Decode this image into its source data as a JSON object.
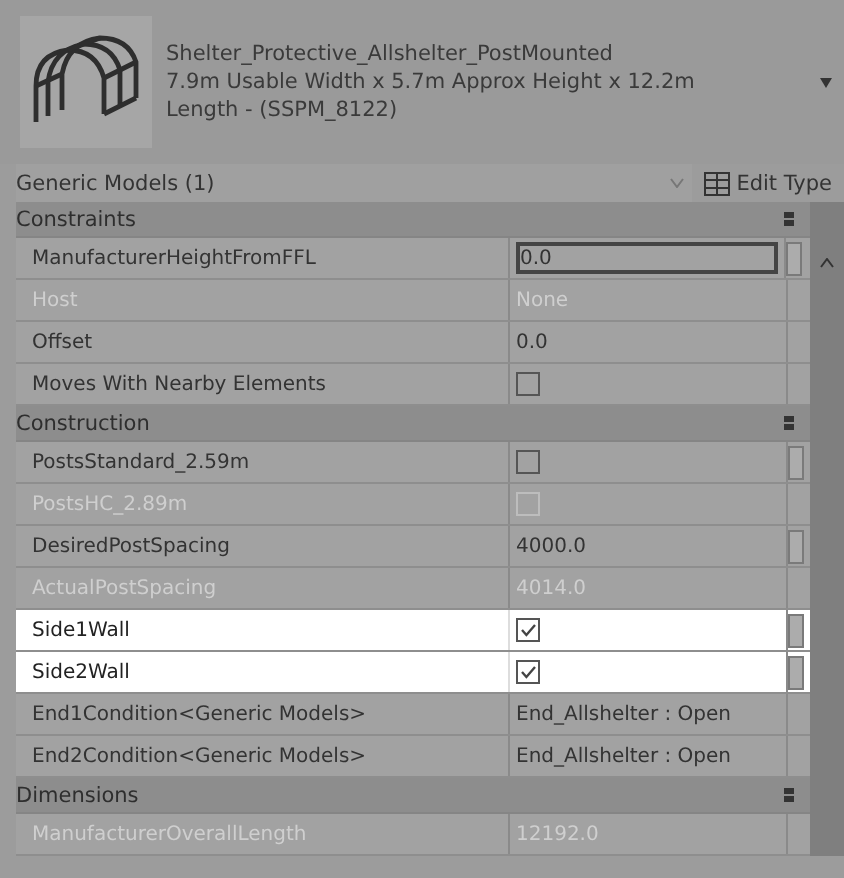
{
  "type_selector": {
    "name_lines": [
      "Shelter_Protective_Allshelter_PostMounted",
      "7.9m Usable Width x 5.7m Approx Height x 12.2m",
      "Length - (SSPM_8122)"
    ]
  },
  "instance_selector": {
    "label": "Generic Models (1)",
    "edit_type": "Edit Type"
  },
  "groups": [
    {
      "title": "Constraints",
      "rows": [
        {
          "name": "ManufacturerHeightFromFFL",
          "kind": "text",
          "value": "0.0",
          "disabled": false,
          "focused": true,
          "highlighted": false,
          "button": true
        },
        {
          "name": "Host",
          "kind": "text",
          "value": "None",
          "disabled": true,
          "focused": false,
          "highlighted": false,
          "button": false
        },
        {
          "name": "Offset",
          "kind": "text",
          "value": "0.0",
          "disabled": false,
          "focused": false,
          "highlighted": false,
          "button": false
        },
        {
          "name": "Moves With Nearby Elements",
          "kind": "checkbox",
          "checked": false,
          "disabled": false,
          "focused": false,
          "highlighted": false,
          "button": false
        }
      ]
    },
    {
      "title": "Construction",
      "rows": [
        {
          "name": "PostsStandard_2.59m",
          "kind": "checkbox",
          "checked": false,
          "disabled": false,
          "focused": false,
          "highlighted": false,
          "button": true
        },
        {
          "name": "PostsHC_2.89m",
          "kind": "checkbox",
          "checked": false,
          "disabled": true,
          "focused": false,
          "highlighted": false,
          "button": false
        },
        {
          "name": "DesiredPostSpacing",
          "kind": "text",
          "value": "4000.0",
          "disabled": false,
          "focused": false,
          "highlighted": false,
          "button": true
        },
        {
          "name": "ActualPostSpacing",
          "kind": "text",
          "value": "4014.0",
          "disabled": true,
          "focused": false,
          "highlighted": false,
          "button": false
        },
        {
          "name": "Side1Wall",
          "kind": "checkbox",
          "checked": true,
          "disabled": false,
          "focused": false,
          "highlighted": true,
          "button": true
        },
        {
          "name": "Side2Wall",
          "kind": "checkbox",
          "checked": true,
          "disabled": false,
          "focused": false,
          "highlighted": true,
          "button": true
        },
        {
          "name": "End1Condition<Generic Models>",
          "kind": "text",
          "value": "End_Allshelter : Open",
          "disabled": false,
          "focused": false,
          "highlighted": false,
          "button": false
        },
        {
          "name": "End2Condition<Generic Models>",
          "kind": "text",
          "value": "End_Allshelter : Open",
          "disabled": false,
          "focused": false,
          "highlighted": false,
          "button": false
        }
      ]
    },
    {
      "title": "Dimensions",
      "rows": [
        {
          "name": "ManufacturerOverallLength",
          "kind": "text",
          "value": "12192.0",
          "disabled": true,
          "focused": false,
          "highlighted": false,
          "button": false
        }
      ]
    }
  ]
}
